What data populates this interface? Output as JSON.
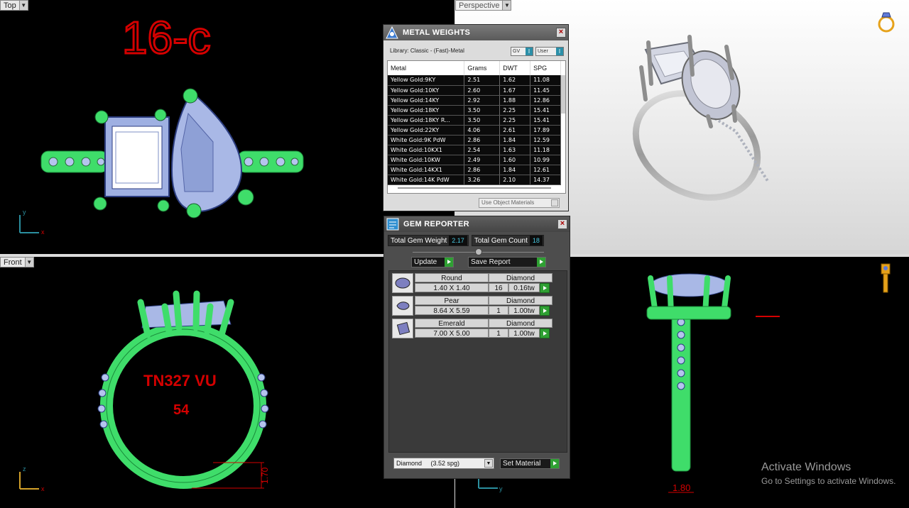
{
  "viewports": {
    "top": {
      "label": "Top",
      "annotation": "16-c"
    },
    "perspective": {
      "label": "Perspective"
    },
    "front": {
      "label": "Front",
      "engraving_line1": "TN327 VU",
      "engraving_line2": "54",
      "dimension": "1.70"
    },
    "right": {
      "label": "",
      "dimension": "1.80"
    }
  },
  "axes": {
    "top_a": "y",
    "top_b": "x",
    "front_a": "z",
    "front_b": "x",
    "right_a": "y"
  },
  "metal_weights": {
    "title": "METAL WEIGHTS",
    "library": "Library: Classic - (Fast)-Metal",
    "gv_label": "GV",
    "user_label": "User",
    "columns": [
      "Metal",
      "Grams",
      "DWT",
      "SPG"
    ],
    "rows": [
      [
        "Yellow Gold:9KY",
        "2.51",
        "1.62",
        "11.08"
      ],
      [
        "Yellow Gold:10KY",
        "2.60",
        "1.67",
        "11.45"
      ],
      [
        "Yellow Gold:14KY",
        "2.92",
        "1.88",
        "12.86"
      ],
      [
        "Yellow Gold:18KY",
        "3.50",
        "2.25",
        "15.41"
      ],
      [
        "Yellow Gold:18KY R...",
        "3.50",
        "2.25",
        "15.41"
      ],
      [
        "Yellow Gold:22KY",
        "4.06",
        "2.61",
        "17.89"
      ],
      [
        "White Gold:9K PdW",
        "2.86",
        "1.84",
        "12.59"
      ],
      [
        "White Gold:10KX1",
        "2.54",
        "1.63",
        "11.18"
      ],
      [
        "White Gold:10KW",
        "2.49",
        "1.60",
        "10.99"
      ],
      [
        "White Gold:14KX1",
        "2.86",
        "1.84",
        "12.61"
      ],
      [
        "White Gold:14K PdW",
        "3.26",
        "2.10",
        "14.37"
      ]
    ],
    "use_object_materials": "Use Object Materials"
  },
  "gem_reporter": {
    "title": "GEM REPORTER",
    "total_weight_label": "Total Gem Weight",
    "total_weight_value": "2.17",
    "total_count_label": "Total Gem Count",
    "total_count_value": "18",
    "update_label": "Update",
    "save_report_label": "Save Report",
    "gems": [
      {
        "shape": "Round",
        "size": "1.40 X 1.40",
        "material": "Diamond",
        "count": "16",
        "weight": "0.16tw"
      },
      {
        "shape": "Pear",
        "size": "8.64 X 5.59",
        "material": "Diamond",
        "count": "1",
        "weight": "1.00tw"
      },
      {
        "shape": "Emerald",
        "size": "7.00 X 5.00",
        "material": "Diamond",
        "count": "1",
        "weight": "1.00tw"
      }
    ],
    "material_select": "Diamond     (3.52 spg)",
    "set_material_label": "Set Material"
  },
  "watermark": {
    "line1": "Activate Windows",
    "line2": "Go to Settings to activate Windows."
  },
  "colors": {
    "metal_green": "#3fdd6a",
    "gem_blue": "#a9b8e6",
    "annotation_red": "#d40000",
    "accent_cyan": "#48c7df",
    "go_green": "#2fa033"
  }
}
